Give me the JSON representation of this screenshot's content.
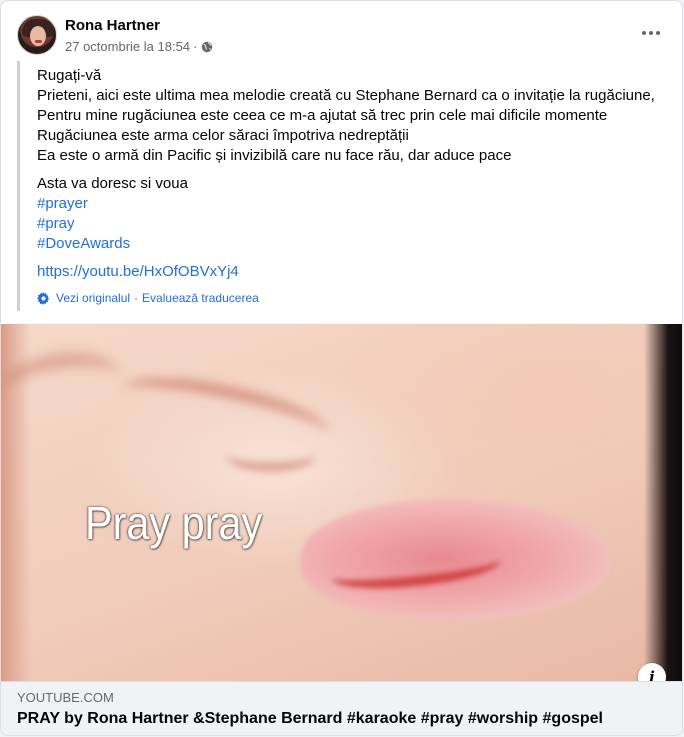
{
  "post": {
    "author": "Rona Hartner",
    "timestamp": "27 octombrie la 18:54",
    "separator": "·",
    "privacy_icon": "globe-icon",
    "more_icon": "more-horizontal-icon"
  },
  "body": {
    "lines": [
      "Rugați-vă",
      "Prieteni, aici este ultima mea melodie creată cu Stephane Bernard ca o invitație la rugăciune,",
      "Pentru mine rugăciunea este ceea ce m-a ajutat să trec prin cele mai dificile momente",
      "Rugăciunea este arma celor săraci împotriva nedreptății",
      "Ea este o armă din Pacific și invizibilă care nu face rău, dar aduce pace"
    ],
    "wish": "Asta va doresc si voua",
    "hashtags": [
      "#prayer",
      "#pray",
      "#DoveAwards"
    ],
    "youtube_link": "https://youtu.be/HxOfOBVxYj4"
  },
  "translation": {
    "icon": "gear-icon",
    "see_original": "Vezi originalul",
    "separator": "·",
    "rate": "Evaluează traducerea"
  },
  "media": {
    "caption": "Pray pray",
    "info_label": "i"
  },
  "link_preview": {
    "domain": "YOUTUBE.COM",
    "title": "PRAY by Rona Hartner &Stephane Bernard #karaoke #pray #worship #gospel"
  },
  "colors": {
    "link": "#216fdb",
    "secondary_text": "#65676b",
    "quote_bar": "#ccd0d5",
    "preview_bg": "#f0f2f5"
  }
}
